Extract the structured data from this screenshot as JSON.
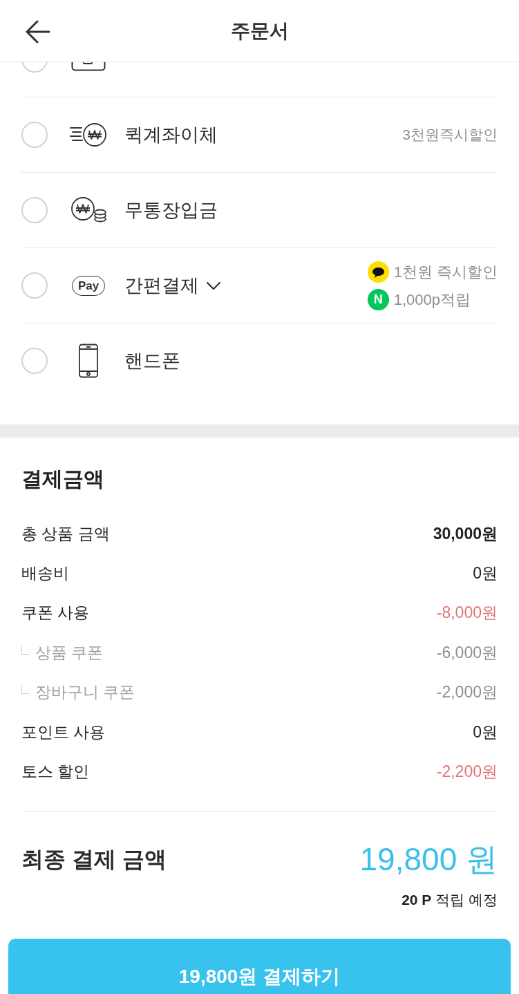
{
  "header": {
    "title": "주문서"
  },
  "payment_methods": [
    {
      "kind": "card",
      "selected": false
    },
    {
      "kind": "quick_transfer",
      "label": "퀵계좌이체",
      "selected": false,
      "note": "3천원즉시할인"
    },
    {
      "kind": "bank_deposit",
      "label": "무통장입금",
      "selected": false
    },
    {
      "kind": "easy_pay",
      "icon_text": "Pay",
      "label": "간편결제",
      "selected": false,
      "expanded": false,
      "benefits": [
        {
          "kind": "chat",
          "color": "#fae100",
          "text": "1천원 즉시할인"
        },
        {
          "kind": "letter",
          "color": "#03c75a",
          "mark": "N",
          "text": "1,000p적립"
        }
      ]
    },
    {
      "kind": "phone",
      "label": "핸드폰",
      "selected": false
    }
  ],
  "payment_summary": {
    "title": "결제금액",
    "rows": [
      {
        "kind": "bold",
        "label": "총 상품 금액",
        "amount": "30,000원"
      },
      {
        "kind": "plain",
        "label": "배송비",
        "amount": "0원"
      },
      {
        "kind": "discount",
        "label": "쿠폰 사용",
        "amount": "-8,000원"
      },
      {
        "kind": "sub",
        "label": "상품 쿠폰",
        "amount": "-6,000원"
      },
      {
        "kind": "sub",
        "label": "장바구니 쿠폰",
        "amount": "-2,000원"
      },
      {
        "kind": "plain",
        "label": "포인트 사용",
        "amount": "0원"
      },
      {
        "kind": "discount",
        "label": "토스 할인",
        "amount": "-2,200원"
      }
    ],
    "total": {
      "label": "최종 결제 금액",
      "amount": "19,800 원",
      "points_note": "**20 P** 적립 예정"
    }
  },
  "pay_button": {
    "label": "19,800원 결제하기"
  }
}
